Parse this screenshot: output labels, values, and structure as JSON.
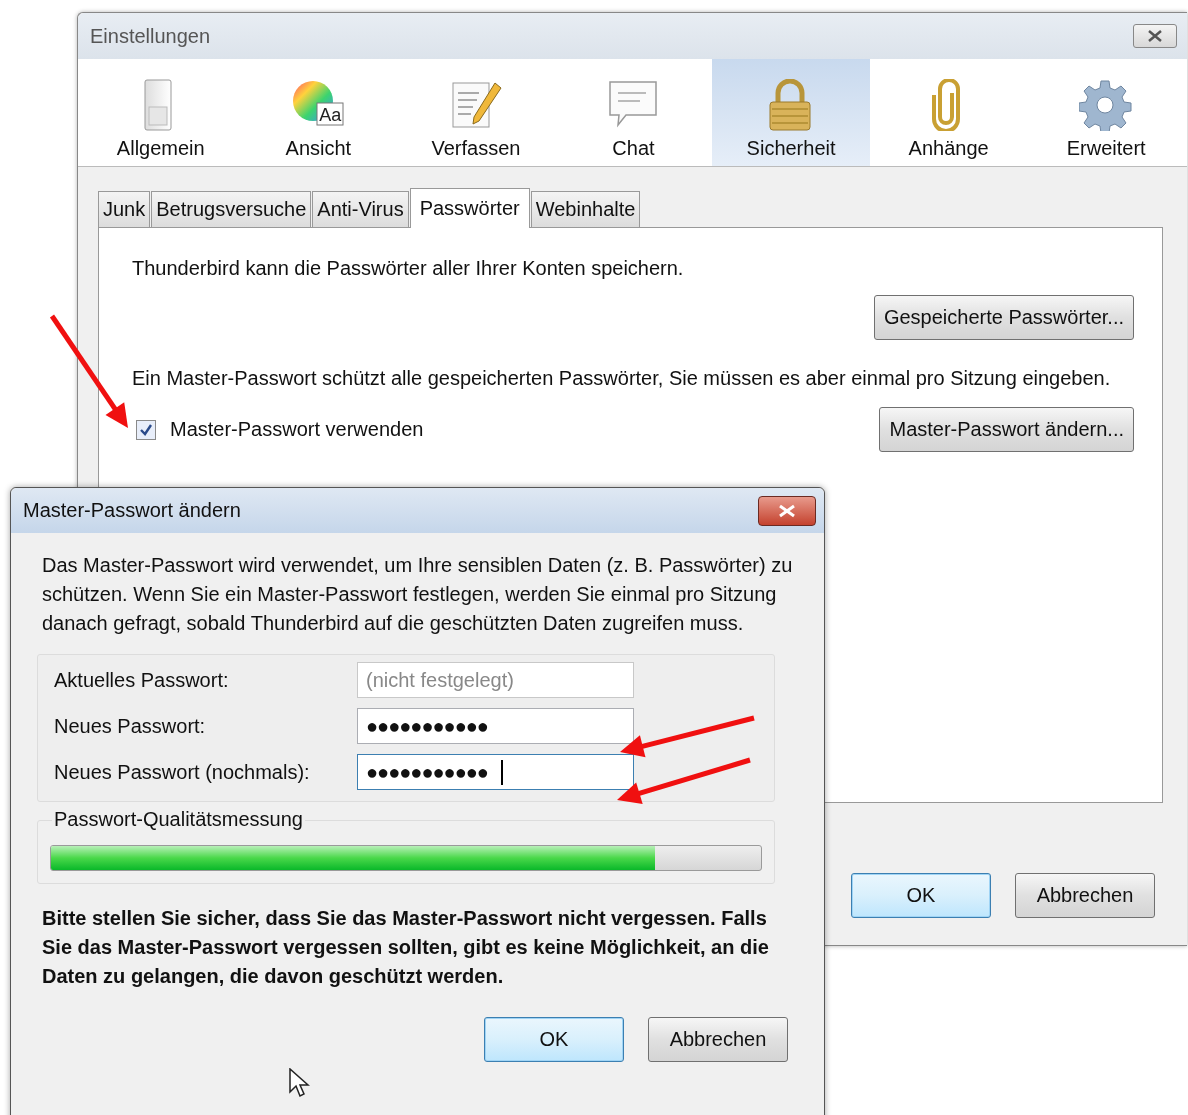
{
  "main_window": {
    "title": "Einstellungen",
    "toolbar": [
      {
        "label": "Allgemein",
        "selected": false
      },
      {
        "label": "Ansicht",
        "selected": false,
        "icon_text": "Aa"
      },
      {
        "label": "Verfassen",
        "selected": false
      },
      {
        "label": "Chat",
        "selected": false
      },
      {
        "label": "Sicherheit",
        "selected": true
      },
      {
        "label": "Anhänge",
        "selected": false
      },
      {
        "label": "Erweitert",
        "selected": false
      }
    ],
    "tabs": [
      {
        "label": "Junk",
        "selected": false
      },
      {
        "label": "Betrugsversuche",
        "selected": false
      },
      {
        "label": "Anti-Virus",
        "selected": false
      },
      {
        "label": "Passwörter",
        "selected": true
      },
      {
        "label": "Webinhalte",
        "selected": false
      }
    ],
    "panel": {
      "intro": "Thunderbird kann die Passwörter aller Ihrer Konten speichern.",
      "saved_passwords_button": "Gespeicherte Passwörter...",
      "master_text": "Ein Master-Passwort schützt alle gespeicherten Passwörter, Sie müssen es aber einmal pro Sitzung eingeben.",
      "master_checkbox": {
        "label": "Master-Passwort verwenden",
        "checked": true
      },
      "change_button": "Master-Passwort ändern..."
    },
    "buttons": [
      {
        "label": "OK",
        "default": true
      },
      {
        "label": "Abbrechen",
        "default": false
      }
    ]
  },
  "dialog": {
    "title": "Master-Passwort ändern",
    "description": "Das Master-Passwort wird verwendet, um Ihre sensiblen Daten (z. B. Passwörter) zu schützen. Wenn Sie ein Master-Passwort festlegen, werden Sie einmal pro Sitzung danach gefragt, sobald Thunderbird auf die geschützten Daten zugreifen muss.",
    "fields": [
      {
        "label": "Aktuelles Passwort:",
        "placeholder": "(nicht festgelegt)",
        "disabled": true,
        "focused": false
      },
      {
        "label": "Neues Passwort:",
        "value": "●●●●●●●●●●●",
        "disabled": false,
        "focused": false
      },
      {
        "label": "Neues Passwort (nochmals):",
        "value": "●●●●●●●●●●●",
        "disabled": false,
        "focused": true
      }
    ],
    "quality": {
      "label": "Passwort-Qualitätsmessung",
      "level": 0.85
    },
    "warning": "Bitte stellen Sie sicher, dass Sie das Master-Passwort nicht vergessen. Falls Sie das Master-Passwort vergessen sollten, gibt es keine Möglichkeit, an die Daten zu gelangen, die davon geschützt werden.",
    "buttons": [
      {
        "label": "OK",
        "default": true
      },
      {
        "label": "Abbrechen",
        "default": false
      }
    ]
  }
}
